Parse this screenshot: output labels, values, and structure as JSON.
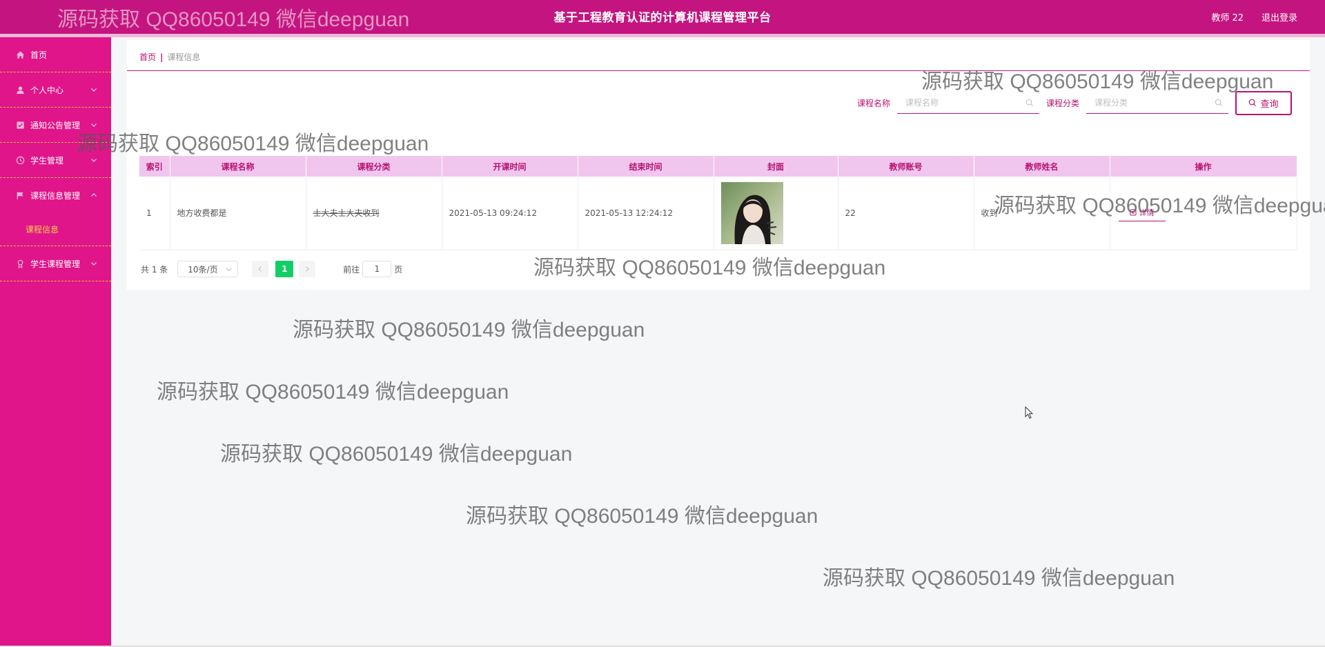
{
  "header": {
    "title": "基于工程教育认证的计算机课程管理平台",
    "user": "教师 22",
    "logout": "退出登录"
  },
  "sidebar": {
    "items": [
      {
        "label": "首页",
        "icon": "home-icon"
      },
      {
        "label": "个人中心",
        "icon": "user-icon"
      },
      {
        "label": "通知公告管理",
        "icon": "notice-icon"
      },
      {
        "label": "学生管理",
        "icon": "clock-icon"
      },
      {
        "label": "课程信息管理",
        "icon": "flag-icon",
        "sub": "课程信息"
      },
      {
        "label": "学生课程管理",
        "icon": "medal-icon"
      }
    ]
  },
  "breadcrumb": {
    "home": "首页",
    "sep": "|",
    "current": "课程信息"
  },
  "search": {
    "name_label": "课程名称",
    "name_placeholder": "课程名称",
    "category_label": "课程分类",
    "category_placeholder": "课程分类",
    "query_button": "查询"
  },
  "table": {
    "headers": [
      "索引",
      "课程名称",
      "课程分类",
      "开课时间",
      "结束时间",
      "封面",
      "教师账号",
      "教师姓名",
      "操作"
    ],
    "rows": [
      {
        "index": "1",
        "name": "地方收费都是",
        "category": "士大夫士大夫收到",
        "start": "2021-05-13 09:24:12",
        "end": "2021-05-13 12:24:12",
        "teacher_account": "22",
        "teacher_name": "收到",
        "action": "详情"
      }
    ]
  },
  "pager": {
    "total": "共 1 条",
    "page_size": "10条/页",
    "current_page": "1",
    "goto_label": "前往",
    "goto_value": "1",
    "page_suffix": "页"
  },
  "watermark": "源码获取 QQ86050149 微信deepguan",
  "colors": {
    "header": "#c4147f",
    "sidebar": "#e0158a",
    "accent": "#b8126f",
    "table_header": "#f0c6ef",
    "active_page": "#13ce66",
    "submenu_text": "#f6d24a"
  }
}
